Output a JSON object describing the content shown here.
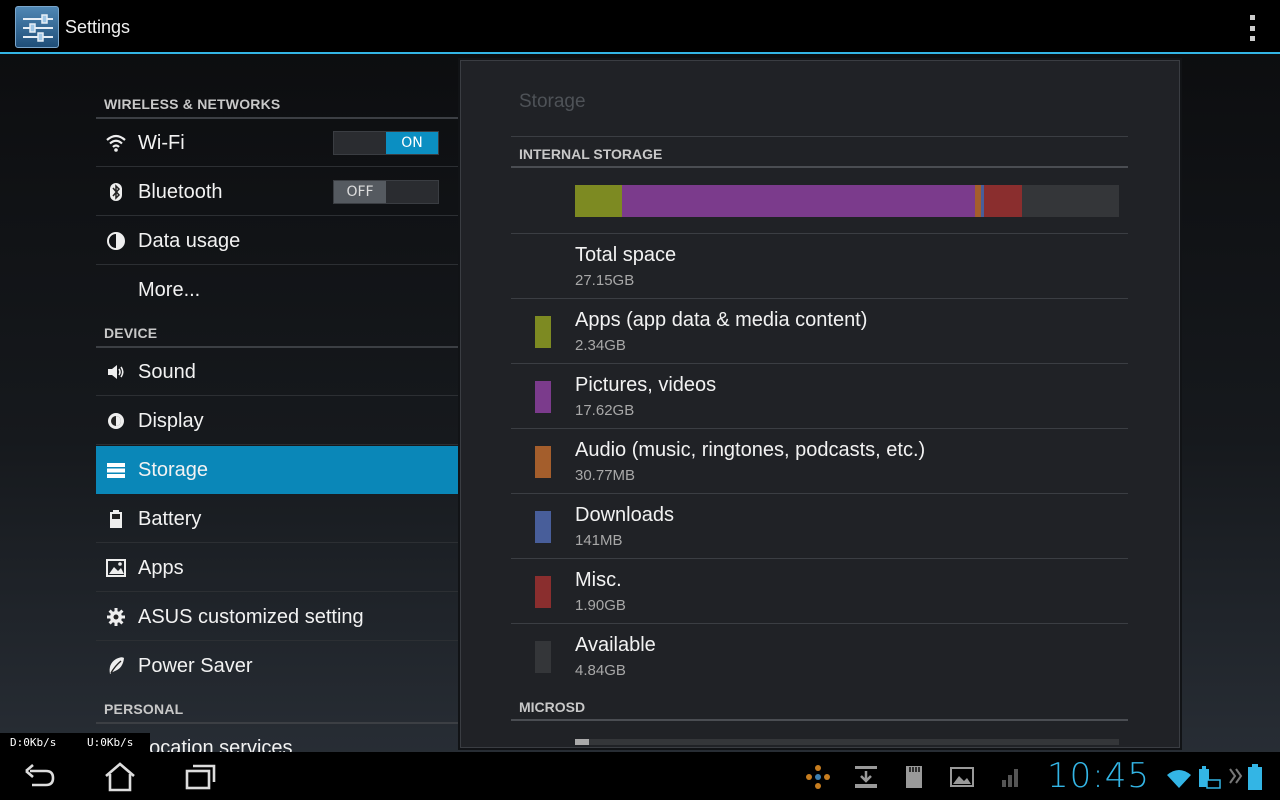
{
  "app": {
    "title": "Settings"
  },
  "colors": {
    "accent": "#33b5e5",
    "selected": "#0a87b8"
  },
  "left": {
    "wireless_header": "WIRELESS & NETWORKS",
    "wifi": {
      "label": "Wi-Fi",
      "toggle": "ON"
    },
    "bluetooth": {
      "label": "Bluetooth",
      "toggle": "OFF"
    },
    "data_usage": "Data usage",
    "more": "More...",
    "device_header": "DEVICE",
    "sound": "Sound",
    "display": "Display",
    "storage": "Storage",
    "battery": "Battery",
    "apps": "Apps",
    "asus": "ASUS customized setting",
    "power_saver": "Power Saver",
    "personal_header": "PERSONAL",
    "location": "Location services"
  },
  "panel": {
    "title": "Storage",
    "internal_header": "INTERNAL STORAGE",
    "sd_header": "MICROSD",
    "usage_fractions": {
      "apps": 0.086,
      "pictures": 0.649,
      "audio": 0.011,
      "downloads": 0.005,
      "misc": 0.07,
      "available": 0.178
    },
    "items": [
      {
        "name": "Total space",
        "size": "27.15GB",
        "color": ""
      },
      {
        "name": "Apps (app data & media content)",
        "size": "2.34GB",
        "color": "#7d8a22"
      },
      {
        "name": "Pictures, videos",
        "size": "17.62GB",
        "color": "#7b3b8c"
      },
      {
        "name": "Audio (music, ringtones, podcasts, etc.)",
        "size": "30.77MB",
        "color": "#a45e2c"
      },
      {
        "name": "Downloads",
        "size": "141MB",
        "color": "#485e9a"
      },
      {
        "name": "Misc.",
        "size": "1.90GB",
        "color": "#8a2e2e"
      },
      {
        "name": "Available",
        "size": "4.84GB",
        "color": "#343639"
      }
    ]
  },
  "netspeed": {
    "down": "D:0Kb/s",
    "up": "U:0Kb/s"
  },
  "status": {
    "time": "10:45"
  }
}
